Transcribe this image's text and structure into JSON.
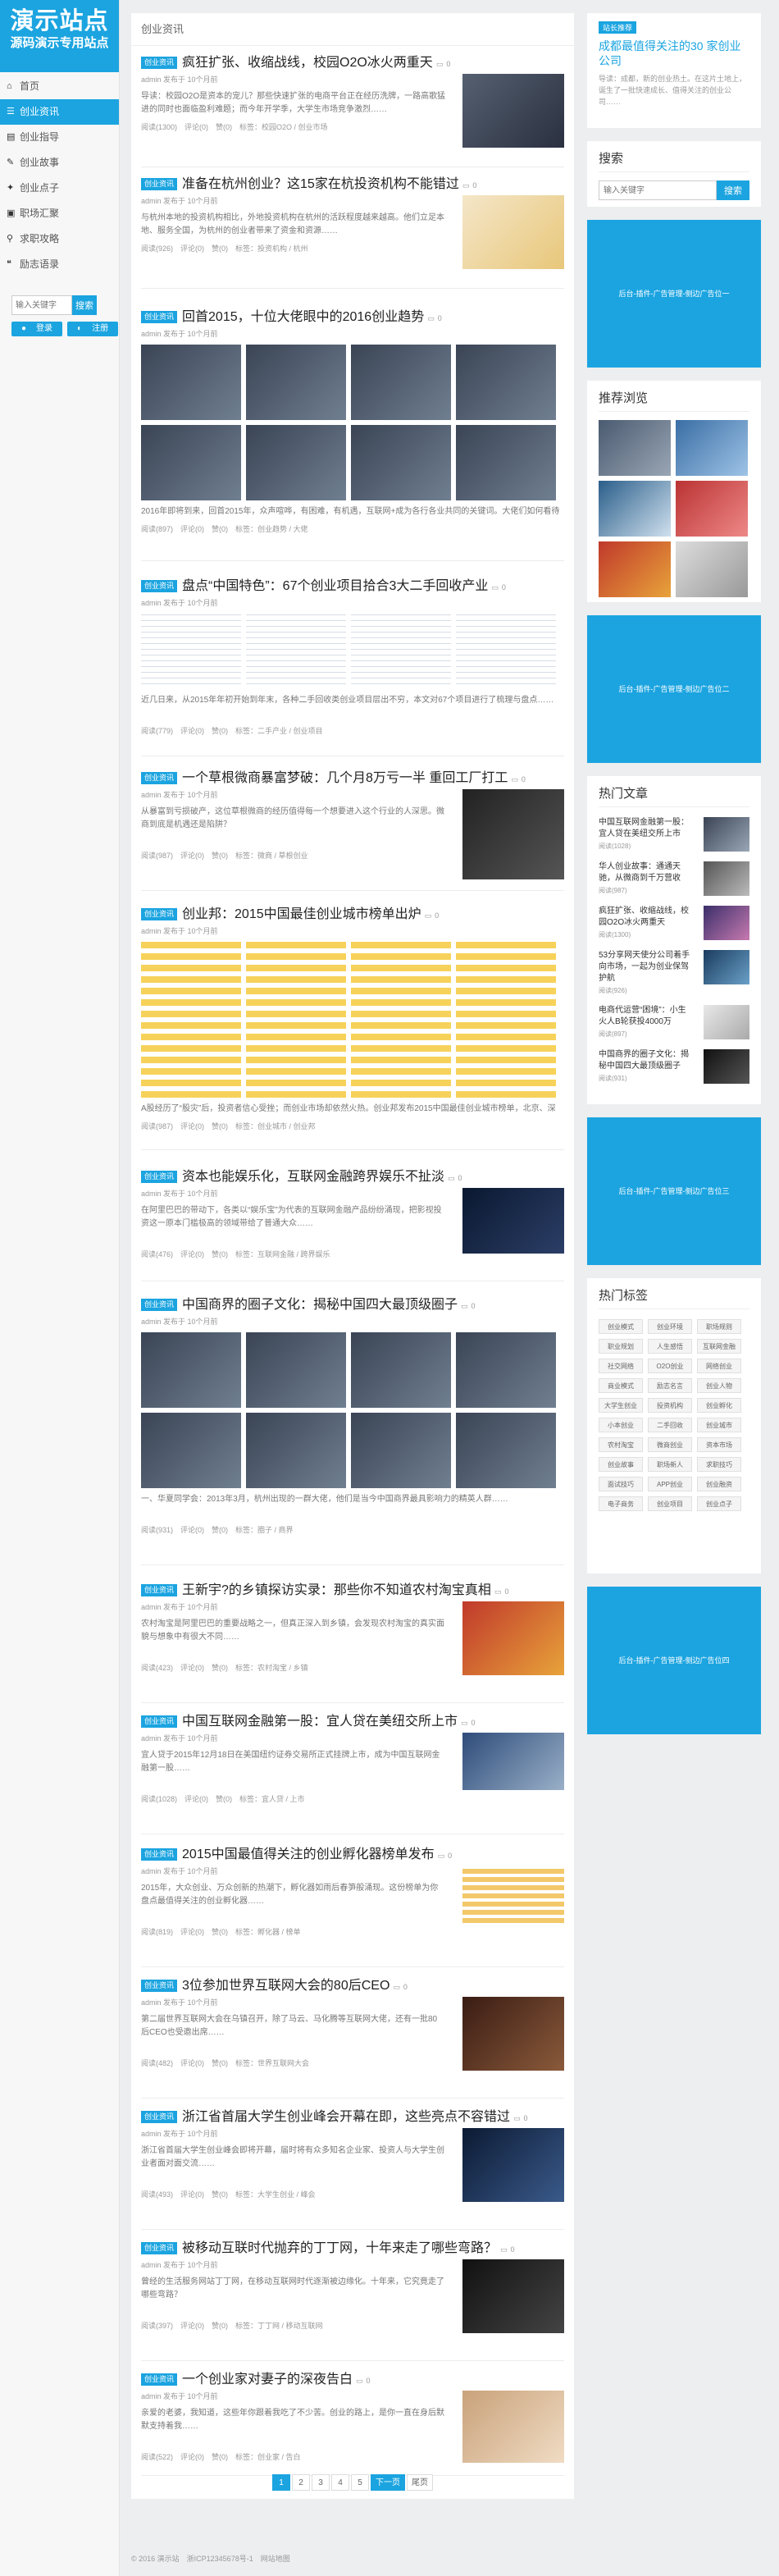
{
  "logo": {
    "line1": "演示站点",
    "line2": "源码演示专用站点"
  },
  "nav": [
    {
      "label": "首页",
      "icon": "home-icon",
      "glyph": "⌂"
    },
    {
      "label": "创业资讯",
      "icon": "list-icon",
      "glyph": "☰"
    },
    {
      "label": "创业指导",
      "icon": "book-icon",
      "glyph": "▤"
    },
    {
      "label": "创业故事",
      "icon": "bookmark-icon",
      "glyph": "✎"
    },
    {
      "label": "创业点子",
      "icon": "bulb-icon",
      "glyph": "✦"
    },
    {
      "label": "职场汇聚",
      "icon": "briefcase-icon",
      "glyph": "▣"
    },
    {
      "label": "求职攻略",
      "icon": "search-icon",
      "glyph": "⚲"
    },
    {
      "label": "励志语录",
      "icon": "quote-icon",
      "glyph": "❝"
    }
  ],
  "side_search": {
    "placeholder": "输入关键字",
    "button": "搜索"
  },
  "side_login": {
    "login": "登录",
    "register": "注册"
  },
  "breadcrumb": "创业资讯",
  "meta_text": "admin 发布于 10个月前",
  "posts": [
    {
      "badge": "创业资讯",
      "title": "疯狂扩张、收缩战线，校园O2O冰火两重天",
      "comments": "0",
      "desc": "导读：校园O2O是资本的宠儿？那些快速扩张的电商平台正在经历洗牌，一路高歌猛进的同时也面临盈利难题；而今年开学季，大学生市场竞争激烈……",
      "foot": "阅读(1300)　评论(0)　赞(0)　标签：校园O2O / 创业市场"
    },
    {
      "badge": "创业资讯",
      "title": "准备在杭州创业？这15家在杭投资机构不能错过",
      "comments": "0",
      "desc": "与杭州本地的投资机构相比，外地投资机构在杭州的活跃程度越来越高。他们立足本地、服务全国，为杭州的创业者带来了资金和资源……",
      "foot": "阅读(926)　评论(0)　赞(0)　标签：投资机构 / 杭州"
    },
    {
      "badge": "创业资讯",
      "title": "回首2015，十位大佬眼中的2016创业趋势",
      "comments": "0",
      "desc": "2016年即将到来，回首2015年，众声喧哗，有困难，有机遇，互联网+成为各行各业共同的关键词。大佬们如何看待2016年的创业趋势？",
      "foot": "阅读(897)　评论(0)　赞(0)　标签：创业趋势 / 大佬"
    },
    {
      "badge": "创业资讯",
      "title": "盘点“中国特色”：67个创业项目拾合3大二手回收产业",
      "comments": "0",
      "desc": "近几日来，从2015年年初开始到年末，各种二手回收类创业项目层出不穷，本文对67个项目进行了梳理与盘点……",
      "foot": "阅读(779)　评论(0)　赞(0)　标签：二手产业 / 创业项目"
    },
    {
      "badge": "创业资讯",
      "title": "一个草根微商暴富梦破：几个月8万亏一半 重回工厂打工",
      "comments": "0",
      "desc": "从暴富到亏损破产，这位草根微商的经历值得每一个想要进入这个行业的人深思。微商到底是机遇还是陷阱？",
      "foot": "阅读(987)　评论(0)　赞(0)　标签：微商 / 草根创业"
    },
    {
      "badge": "创业资讯",
      "title": "创业邦：2015中国最佳创业城市榜单出炉",
      "comments": "0",
      "desc": "A股经历了“股灾”后，投资者信心受挫；而创业市场却依然火热。创业邦发布2015中国最佳创业城市榜单，北京、深圳、上海、杭州位居前列……",
      "foot": "阅读(987)　评论(0)　赞(0)　标签：创业城市 / 创业邦"
    },
    {
      "badge": "创业资讯",
      "title": "资本也能娱乐化，互联网金融跨界娱乐不扯淡",
      "comments": "0",
      "desc": "在阿里巴巴的带动下，各类以“娱乐宝”为代表的互联网金融产品纷纷涌现，把影视投资这一原本门槛极高的领域带给了普通大众……",
      "foot": "阅读(476)　评论(0)　赞(0)　标签：互联网金融 / 跨界娱乐"
    },
    {
      "badge": "创业资讯",
      "title": "中国商界的圈子文化：揭秘中国四大最顶级圈子",
      "comments": "0",
      "desc": "一、华夏同学会：2013年3月，杭州出现的一群大佬，他们是当今中国商界最具影响力的精英人群……",
      "foot": "阅读(931)　评论(0)　赞(0)　标签：圈子 / 商界"
    },
    {
      "badge": "创业资讯",
      "title": "王新宇?的乡镇探访实录：那些你不知道农村淘宝真相",
      "comments": "0",
      "desc": "农村淘宝是阿里巴巴的重要战略之一，但真正深入到乡镇，会发现农村淘宝的真实面貌与想象中有很大不同……",
      "foot": "阅读(423)　评论(0)　赞(0)　标签：农村淘宝 / 乡镇"
    },
    {
      "badge": "创业资讯",
      "title": "中国互联网金融第一股：宜人贷在美纽交所上市",
      "comments": "0",
      "desc": "宜人贷于2015年12月18日在美国纽约证券交易所正式挂牌上市，成为中国互联网金融第一股……",
      "foot": "阅读(1028)　评论(0)　赞(0)　标签：宜人贷 / 上市"
    },
    {
      "badge": "创业资讯",
      "title": "2015中国最值得关注的创业孵化器榜单发布",
      "comments": "0",
      "desc": "2015年，大众创业、万众创新的热潮下，孵化器如雨后春笋般涌现。这份榜单为你盘点最值得关注的创业孵化器……",
      "foot": "阅读(819)　评论(0)　赞(0)　标签：孵化器 / 榜单"
    },
    {
      "badge": "创业资讯",
      "title": "3位参加世界互联网大会的80后CEO",
      "comments": "0",
      "desc": "第二届世界互联网大会在乌镇召开，除了马云、马化腾等互联网大佬，还有一批80后CEO也受邀出席……",
      "foot": "阅读(482)　评论(0)　赞(0)　标签：世界互联网大会"
    },
    {
      "badge": "创业资讯",
      "title": "浙江省首届大学生创业峰会开幕在即，这些亮点不容错过",
      "comments": "0",
      "desc": "浙江省首届大学生创业峰会即将开幕，届时将有众多知名企业家、投资人与大学生创业者面对面交流……",
      "foot": "阅读(493)　评论(0)　赞(0)　标签：大学生创业 / 峰会"
    },
    {
      "badge": "创业资讯",
      "title": "被移动互联时代抛弃的丁丁网，十年来走了哪些弯路？",
      "comments": "0",
      "desc": "曾经的生活服务网站丁丁网，在移动互联网时代逐渐被边缘化。十年来，它究竟走了哪些弯路？",
      "foot": "阅读(397)　评论(0)　赞(0)　标签：丁丁网 / 移动互联网"
    },
    {
      "badge": "创业资讯",
      "title": "一个创业家对妻子的深夜告白",
      "comments": "0",
      "desc": "亲爱的老婆，我知道，这些年你跟着我吃了不少苦。创业的路上，是你一直在身后默默支持着我……",
      "foot": "阅读(522)　评论(0)　赞(0)　标签：创业家 / 告白"
    }
  ],
  "pager": {
    "pages": [
      "1",
      "2",
      "3",
      "4",
      "5"
    ],
    "next": "下一页",
    "last": "尾页"
  },
  "footer": "© 2016 演示站　浙ICP12345678号-1　网站地图",
  "featured": {
    "tag": "站长推荐",
    "title": "成都最值得关注的30 家创业公司",
    "desc": "导读：成都，新的创业热土。在这片土地上，诞生了一批快速成长、值得关注的创业公司……"
  },
  "right_search": {
    "title": "搜索",
    "placeholder": "输入关键字",
    "button": "搜索"
  },
  "ad_text": "后台-插件-广告管理-侧边广告位",
  "ad_texts": [
    "后台-插件-广告管理-侧边广告位一",
    "后台-插件-广告管理-侧边广告位二",
    "后台-插件-广告管理-侧边广告位三",
    "后台-插件-广告管理-侧边广告位四"
  ],
  "recommend_title": "推荐浏览",
  "hot_title": "热门文章",
  "hot": [
    {
      "title": "中国互联网金融第一股：宜人贷在美纽交所上市",
      "views": "阅读(1028)"
    },
    {
      "title": "华人创业故事：通通天驰，从微商到千万营收",
      "views": "阅读(987)"
    },
    {
      "title": "疯狂扩张、收缩战线，校园O2O冰火两重天",
      "views": "阅读(1300)"
    },
    {
      "title": "53分享网天使分公司着手向市场，一起为创业保驾护航",
      "views": "阅读(926)"
    },
    {
      "title": "电商代运营“困境”：小生火人B轮获投4000万",
      "views": "阅读(897)"
    },
    {
      "title": "中国商界的圈子文化：揭秘中国四大最顶级圈子",
      "views": "阅读(931)"
    }
  ],
  "tags_title": "热门标签",
  "tags": [
    "创业模式",
    "创业环境",
    "职场规则",
    "职业规划",
    "人生感悟",
    "互联网金融",
    "社交网络",
    "O2O创业",
    "网络创业",
    "商业模式",
    "励志名言",
    "创业人物",
    "大学生创业",
    "投资机构",
    "创业孵化",
    "小本创业",
    "二手回收",
    "创业城市",
    "农村淘宝",
    "微商创业",
    "资本市场",
    "创业故事",
    "职场新人",
    "求职技巧",
    "面试技巧",
    "APP创业",
    "创业融资",
    "电子商务",
    "创业项目",
    "创业点子"
  ]
}
